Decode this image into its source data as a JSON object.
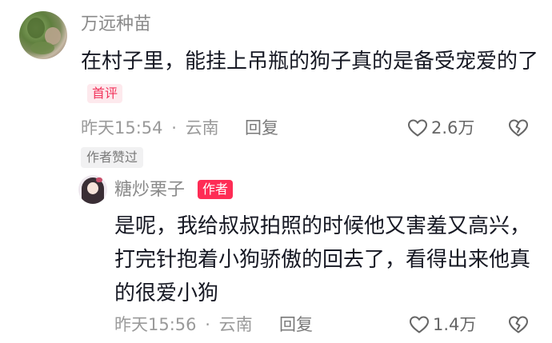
{
  "comment": {
    "username": "万远种苗",
    "text": "在村子里，能挂上吊瓶的狗子真的是备受宠爱的了",
    "first_tag": "首评",
    "time": "昨天15:54",
    "separator": "·",
    "location": "云南",
    "reply_label": "回复",
    "likes": "2.6万",
    "author_liked_label": "作者赞过",
    "icons": [
      "heart-outline-icon",
      "broken-heart-icon"
    ]
  },
  "reply": {
    "username": "糖炒栗子",
    "author_tag": "作者",
    "text": "是呢，我给叔叔拍照的时候他又害羞又高兴，打完针抱着小狗骄傲的回去了，看得出来他真的很爱小狗",
    "time": "昨天15:56",
    "separator": "·",
    "location": "云南",
    "reply_label": "回复",
    "likes": "1.4万",
    "icons": [
      "heart-outline-icon",
      "broken-heart-icon"
    ]
  },
  "colors": {
    "text_primary": "#161823",
    "text_secondary": "#8a8a8a",
    "accent": "#fe2c55",
    "first_tag_bg": "#fde9ed"
  }
}
